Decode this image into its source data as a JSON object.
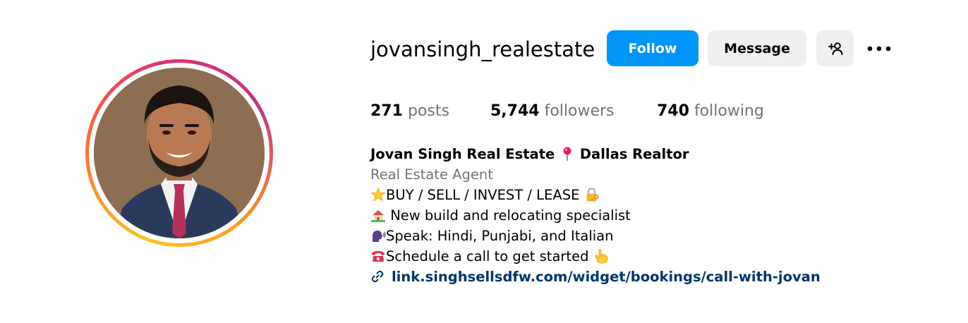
{
  "profile": {
    "username": "jovansingh_realestate",
    "avatar_alt": "profile photo"
  },
  "actions": {
    "follow_label": "Follow",
    "message_label": "Message",
    "add_user_icon": "person-plus-icon",
    "more_icon": "more-options-icon"
  },
  "stats": {
    "posts_count": "271",
    "posts_label": "posts",
    "followers_count": "5,744",
    "followers_label": "followers",
    "following_count": "740",
    "following_label": "following"
  },
  "bio": {
    "name_part1": "Jovan Singh Real Estate ",
    "name_part2": " Dallas Realtor",
    "category": "Real Estate Agent",
    "line1": "BUY / SELL / INVEST / LEASE ",
    "line2": " New build and relocating specialist",
    "line3": "Speak: Hindi, Punjabi, and Italian",
    "line4": "Schedule a call to get started ",
    "link": "link.singhsellsdfw.com/widget/bookings/call-with-jovan"
  },
  "colors": {
    "follow_bg": "#0095f6",
    "secondary_bg": "#efefef",
    "muted_text": "#737373",
    "link_text": "#00376b"
  }
}
